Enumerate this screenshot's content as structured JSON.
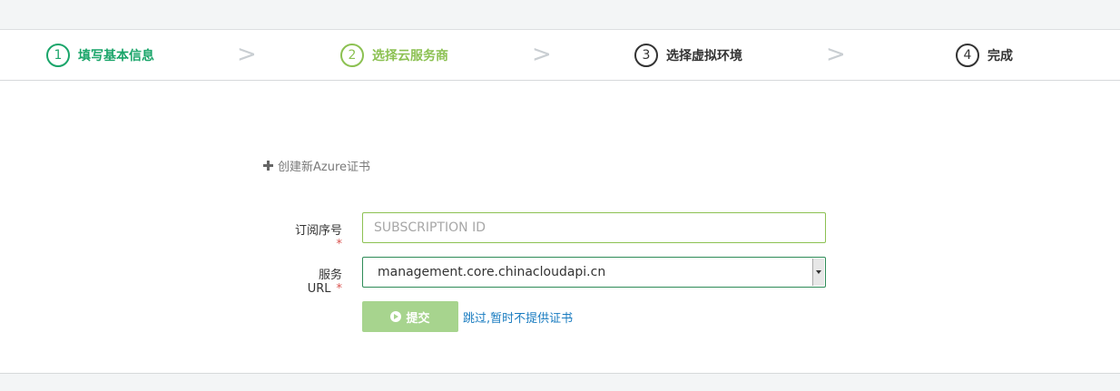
{
  "steps": [
    {
      "num": "1",
      "label": "填写基本信息",
      "state": "done"
    },
    {
      "num": "2",
      "label": "选择云服务商",
      "state": "current"
    },
    {
      "num": "3",
      "label": "选择虚拟环境",
      "state": "pending"
    },
    {
      "num": "4",
      "label": "完成",
      "state": "pending"
    }
  ],
  "separator": ">",
  "create_cert_link": "创建新Azure证书",
  "form": {
    "subscription": {
      "label": "订阅序号",
      "required_mark": "*",
      "placeholder": "SUBSCRIPTION ID",
      "value": ""
    },
    "service_url": {
      "label": "服务URL",
      "required_mark": "*",
      "selected": "management.core.chinacloudapi.cn"
    },
    "submit_label": "提交",
    "skip_label": "跳过,暂时不提供证书"
  },
  "colors": {
    "done": "#1aa56a",
    "current": "#8cc152",
    "pending": "#333333",
    "submit_bg": "#a7d48e",
    "link": "#1a7cc0",
    "required": "#d9534f"
  }
}
